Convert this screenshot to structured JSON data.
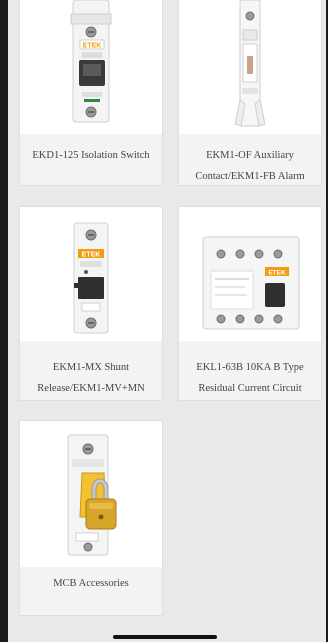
{
  "products": [
    {
      "name": "EKD1-125 Isolation Switch",
      "image": "isolation-switch-icon"
    },
    {
      "name": "EKM1-OF Auxiliary Contact/EKM1-FB Alarm",
      "image": "auxiliary-contact-icon"
    },
    {
      "name": "EKM1-MX Shunt Release/EKM1-MV+MN",
      "image": "shunt-release-icon"
    },
    {
      "name": "EKL1-63B 10KA B Type Residual Current Circuit",
      "image": "rcd-breaker-icon"
    },
    {
      "name": "MCB Accessories",
      "image": "padlock-breaker-icon"
    }
  ],
  "brand_logo": "ETEK",
  "colors": {
    "page_background": "#e9e9e9",
    "card_background": "#f3f3f3",
    "image_background": "#ffffff",
    "text": "#444444",
    "brand_orange": "#f39c12",
    "lock_yellow": "#f2c230"
  }
}
